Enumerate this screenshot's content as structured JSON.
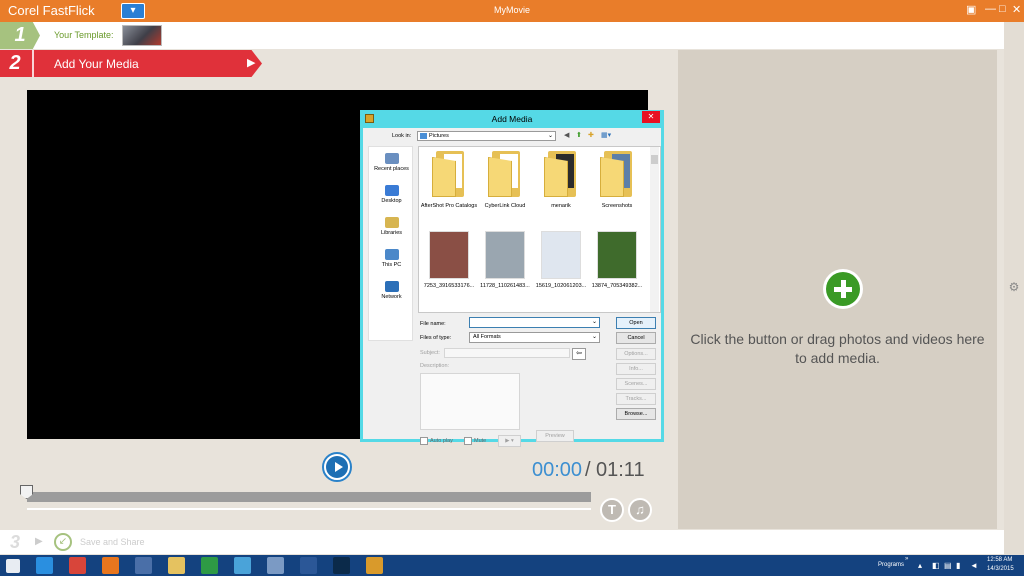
{
  "titlebar": {
    "app_name": "Corel FastFlick",
    "dropdown_glyph": "▾",
    "doc_title": "MyMovie",
    "controls": [
      "▣",
      "—",
      "□",
      "✕"
    ]
  },
  "steps": {
    "step1": {
      "number": "1",
      "label": "Your Template:"
    },
    "step2": {
      "number": "2",
      "label": "Add Your Media",
      "arrow": "▶"
    },
    "step3": {
      "number": "3",
      "label": "Save and Share",
      "chevron": "▶",
      "icon_glyph": "↙"
    }
  },
  "player": {
    "current_time": "00:00",
    "separator": "/",
    "total_time": "01:11",
    "position_fraction": 0.0,
    "text_button": "T",
    "music_button": "♫"
  },
  "media_panel": {
    "hint": "Click the button or drag photos and videos here to add media.",
    "side_glyph": "⚙"
  },
  "dialog": {
    "title": "Add Media",
    "close": "✕",
    "look_in_label": "Look in:",
    "look_in_value": "Pictures",
    "places": [
      {
        "label": "Recent places",
        "color": "#6a8fc0"
      },
      {
        "label": "Desktop",
        "color": "#3a7bd5"
      },
      {
        "label": "Libraries",
        "color": "#d7b551"
      },
      {
        "label": "This PC",
        "color": "#4b88c9"
      },
      {
        "label": "Network",
        "color": "#2b6fb8"
      }
    ],
    "items": [
      {
        "label": "AfterShot Pro Catalogs",
        "kind": "folder",
        "color": "#ffffff"
      },
      {
        "label": "CyberLink Cloud",
        "kind": "folder",
        "color": "#ffffff"
      },
      {
        "label": "menarik",
        "kind": "folder",
        "color": "#2b2b2b"
      },
      {
        "label": "Screenshots",
        "kind": "folder",
        "color": "#5d7fa8"
      },
      {
        "label": "7253_3916533176...",
        "kind": "image",
        "color": "#8a4f45"
      },
      {
        "label": "11728_110261483...",
        "kind": "image",
        "color": "#9aa6b0"
      },
      {
        "label": "15619_102061203...",
        "kind": "image",
        "color": "#dfe6ef"
      },
      {
        "label": "13874_705349382...",
        "kind": "image",
        "color": "#3f6b2c"
      }
    ],
    "file_name_label": "File name:",
    "file_name_value": "",
    "files_of_type_label": "Files of type:",
    "files_of_type_value": "All Formats",
    "subject_label": "Subject:",
    "description_label": "Description:",
    "buttons": {
      "open": "Open",
      "cancel": "Cancel",
      "options": "Options...",
      "info": "Info...",
      "scenes": "Scenes...",
      "tracks": "Tracks...",
      "browse": "Browse...",
      "preview": "Preview"
    },
    "auto_play_label": "Auto play",
    "mute_label": "Mute",
    "play_glyph": "▶ ▾"
  },
  "taskbar": {
    "programs_label": "Programs",
    "time": "12:58 AM",
    "date": "14/3/2015",
    "apps": [
      {
        "name": "internet-explorer-icon",
        "color": "#2a8fe0"
      },
      {
        "name": "chrome-icon",
        "color": "#d8453a"
      },
      {
        "name": "firefox-icon",
        "color": "#e8761e"
      },
      {
        "name": "media-icon",
        "color": "#4a6fa8"
      },
      {
        "name": "file-explorer-icon",
        "color": "#e5c260"
      },
      {
        "name": "store-icon",
        "color": "#2e9a45"
      },
      {
        "name": "paint-icon",
        "color": "#4aa3d9"
      },
      {
        "name": "calculator-icon",
        "color": "#7b9ac4"
      },
      {
        "name": "word-icon",
        "color": "#2b5797"
      },
      {
        "name": "photoshop-icon",
        "color": "#0b2a4a"
      },
      {
        "name": "fastflick-icon",
        "color": "#d99a2b"
      }
    ]
  },
  "colors": {
    "title_orange": "#e97d2a",
    "step2_red": "#e0313a",
    "accent_blue": "#3c8fd1",
    "add_green": "#3a9a25",
    "dialog_cyan": "#55d9e6"
  }
}
